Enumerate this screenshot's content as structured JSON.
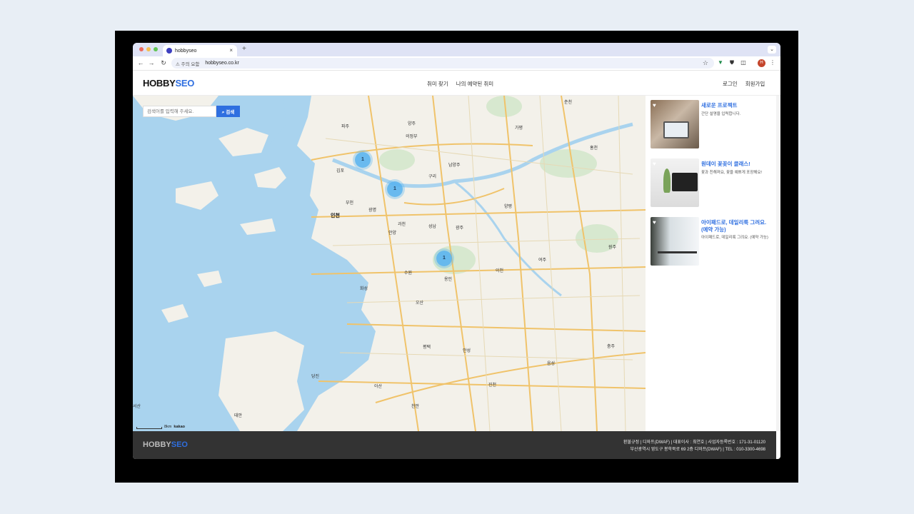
{
  "browser": {
    "tab_title": "hobbyseo",
    "tab_close": "×",
    "new_tab": "+",
    "tab_menu": "⌄",
    "back": "←",
    "forward": "→",
    "reload": "↻",
    "security_warning": "⚠ 주의 요함",
    "url": "hobbyseo.co.kr",
    "star": "☆",
    "profile_initial": "H",
    "menu": "⋮"
  },
  "header": {
    "logo_part1": "HOBBY",
    "logo_part2": "SEO",
    "nav": [
      "취미 찾기",
      "나의 예약된 취미"
    ],
    "login": "로그인",
    "signup": "회원가입"
  },
  "map": {
    "search_placeholder": "검색어를 입력해 주세요.",
    "search_button": "검색",
    "clusters": [
      {
        "count": "1"
      },
      {
        "count": "1"
      },
      {
        "count": "1"
      }
    ],
    "labels": [
      "인천",
      "부천",
      "광명",
      "안양",
      "과천",
      "수원",
      "용인",
      "성남",
      "남양주",
      "구리",
      "의정부",
      "양주",
      "파주",
      "김포",
      "화성",
      "오산",
      "평택",
      "안성",
      "이천",
      "여주",
      "광주",
      "양평",
      "가평",
      "춘천",
      "홍천",
      "원주",
      "충주",
      "진천",
      "아산",
      "천안",
      "당진",
      "서산",
      "태안",
      "음성"
    ],
    "scale_text": "8km",
    "attribution": "kakao"
  },
  "listings": [
    {
      "title": "새로운 프로젝트",
      "desc": "간단 설명을 입력합니다."
    },
    {
      "title": "원데이 꽃꽂이 클래스!",
      "desc": "꽃과 친해져요, 꽃을 예쁘게 포장해요!"
    },
    {
      "title": "아이패드로, 데일리룩 그려요.\n(예약 가능)",
      "desc": "아이패드로, 데일리룩 그려요. (예약 가능)"
    }
  ],
  "footer": {
    "logo_part1": "HOBBY",
    "logo_part2": "SEO",
    "line1": "환불규정 | 디와프(DWAF) | 대표이사 : 최연호 | 사업자등록번호 : 171-31-01120",
    "line2": "부산광역시 영도구 봉학북로 69 2층 디와프(DWAF) | TEL : 010-3300-4698"
  },
  "colors": {
    "brand": "#2f6fe0",
    "sea": "#a9d3ee",
    "cluster": "#5ab4f0"
  }
}
